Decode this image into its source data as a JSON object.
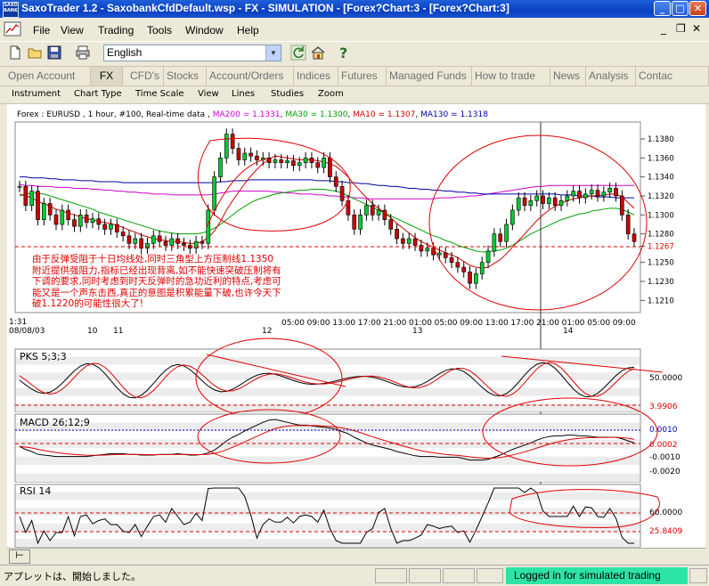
{
  "window": {
    "title": "SaxoTrader 1.2 - SaxobankCfdDefault.wsp - FX - SIMULATION - [Forex?Chart:3 - [Forex?Chart:3]",
    "app_icon_text": "SAXO BANK"
  },
  "menu": {
    "items": [
      "File",
      "View",
      "Trading",
      "Tools",
      "Window",
      "Help"
    ]
  },
  "toolbar": {
    "language": "English"
  },
  "nav_tabs": [
    "Open Account",
    "FX",
    "CFD's",
    "Stocks",
    "Account/Orders",
    "Indices",
    "Futures",
    "Managed Funds",
    "How to trade",
    "News",
    "Analysis",
    "Contac"
  ],
  "active_tab": "FX",
  "chart_toolbar": [
    "Instrument",
    "Chart Type",
    "Time Scale",
    "View",
    "Lines",
    "Studies",
    "Zoom"
  ],
  "legend": {
    "prefix": "Forex : EURUSD , 1 hour, #100, Real-time data ,",
    "ma200": "MA200 = 1.1331",
    "ma30": "MA30 = 1.1300",
    "ma10": "MA10 = 1.1307",
    "ma130": "MA130 = 1.1318",
    "colors": {
      "ma200": "#d000d0",
      "ma30": "#00a000",
      "ma10": "#d00000",
      "ma130": "#0000a0"
    }
  },
  "annotation_text": "由于反弹受阻于十日均线处,同时三角型上方压制线1.1350附近提供强阻力,指标已经出现背离,如不能快速突破压制将有下调的要求,同时考虑到时天反弹时的急功近利的特点,考虑可能又是一个声东击西,真正的意图是积累能量下破,也许今天下破1.1220的可能性很大了!",
  "panels": {
    "pks": {
      "label": "PKS 5;3;3",
      "values": [
        "50.0000",
        "3.9906"
      ]
    },
    "macd": {
      "label": "MACD 26;12;9",
      "values": [
        "0.0010",
        "0.0002",
        "-0.0010",
        "-0.0020"
      ]
    },
    "rsi": {
      "label": "RSI 14",
      "values": [
        "60.0000",
        "25.8409"
      ]
    }
  },
  "chart_data": {
    "type": "candlestick",
    "instrument": "EURUSD",
    "timeframe": "1 hour",
    "y_ticks": [
      "1.1380",
      "1.1360",
      "1.1340",
      "1.1320",
      "1.1300",
      "1.1280",
      "1.1267",
      "1.1250",
      "1.1230",
      "1.1210"
    ],
    "ylim": [
      1.12,
      1.1395
    ],
    "current_price": "1.1267",
    "x_date_labels": [
      "1:31",
      "08/08/03",
      "10",
      "11",
      "12",
      "13",
      "14"
    ],
    "x_time_labels": [
      "05:00",
      "09:00",
      "13:00",
      "17:00",
      "21:00",
      "01:00",
      "05:00",
      "09:00",
      "13:00",
      "17:00",
      "21:00",
      "01:00",
      "05:00",
      "09:00"
    ],
    "closes": [
      1.133,
      1.131,
      1.1325,
      1.1295,
      1.1312,
      1.13,
      1.129,
      1.1305,
      1.1295,
      1.1288,
      1.13,
      1.1292,
      1.1296,
      1.129,
      1.1285,
      1.129,
      1.1282,
      1.1278,
      1.127,
      1.1275,
      1.1265,
      1.127,
      1.1278,
      1.1272,
      1.1268,
      1.1275,
      1.127,
      1.1268,
      1.1265,
      1.1272,
      1.127,
      1.1305,
      1.134,
      1.136,
      1.1385,
      1.137,
      1.1358,
      1.1365,
      1.1362,
      1.1358,
      1.136,
      1.1355,
      1.1358,
      1.1355,
      1.1357,
      1.1352,
      1.1355,
      1.136,
      1.1355,
      1.135,
      1.136,
      1.134,
      1.133,
      1.1315,
      1.13,
      1.1285,
      1.13,
      1.131,
      1.13,
      1.1305,
      1.1295,
      1.1285,
      1.1275,
      1.127,
      1.1275,
      1.1268,
      1.1262,
      1.1265,
      1.1258,
      1.126,
      1.1255,
      1.125,
      1.1245,
      1.124,
      1.1228,
      1.1238,
      1.125,
      1.1262,
      1.128,
      1.1272,
      1.129,
      1.1305,
      1.1318,
      1.131,
      1.1315,
      1.132,
      1.1312,
      1.1318,
      1.131,
      1.1315,
      1.132,
      1.1325,
      1.1318,
      1.1322,
      1.1326,
      1.132,
      1.1324,
      1.1328,
      1.132,
      1.13,
      1.128,
      1.1272
    ],
    "ma200": [
      1.1332,
      1.1331,
      1.1331,
      1.133,
      1.133,
      1.133,
      1.1329,
      1.1329,
      1.1329,
      1.1328,
      1.1328,
      1.1328,
      1.1327,
      1.1327,
      1.1326,
      1.1326,
      1.1325,
      1.1325,
      1.1324,
      1.1324,
      1.1323,
      1.1323,
      1.1322,
      1.1322,
      1.1322,
      1.1321,
      1.1321,
      1.1321,
      1.1321,
      1.1321,
      1.1321,
      1.1321,
      1.1322,
      1.1323,
      1.1324,
      1.1325,
      1.1325,
      1.1325,
      1.1325,
      1.1325,
      1.1325,
      1.1325,
      1.1324,
      1.1324,
      1.1323,
      1.1323,
      1.1322,
      1.1322,
      1.1322,
      1.1321,
      1.1321,
      1.132,
      1.132,
      1.1319,
      1.1319,
      1.1318,
      1.1318,
      1.1317,
      1.1317,
      1.1317,
      1.1317,
      1.1317,
      1.1317,
      1.1317,
      1.1317,
      1.1317,
      1.1317,
      1.1317,
      1.1317,
      1.1318,
      1.1318,
      1.1318,
      1.1319,
      1.1319,
      1.132,
      1.132,
      1.1321,
      1.1322,
      1.1323,
      1.1324,
      1.1325,
      1.1326,
      1.1327,
      1.1328,
      1.1329,
      1.133,
      1.133,
      1.1331,
      1.1331,
      1.1331,
      1.1331,
      1.1331,
      1.1331,
      1.1331,
      1.1331,
      1.1331,
      1.1331,
      1.1331,
      1.1331,
      1.1331,
      1.1331,
      1.1331
    ],
    "ma130": [
      1.134,
      1.134,
      1.1339,
      1.1339,
      1.1339,
      1.1338,
      1.1338,
      1.1337,
      1.1337,
      1.1337,
      1.1336,
      1.1336,
      1.1336,
      1.1335,
      1.1335,
      1.1335,
      1.1335,
      1.1334,
      1.1334,
      1.1334,
      1.1334,
      1.1334,
      1.1334,
      1.1334,
      1.1334,
      1.1334,
      1.1334,
      1.1334,
      1.1334,
      1.1334,
      1.1334,
      1.1334,
      1.1334,
      1.1335,
      1.1335,
      1.1336,
      1.1336,
      1.1336,
      1.1337,
      1.1337,
      1.1337,
      1.1337,
      1.1337,
      1.1337,
      1.1337,
      1.1337,
      1.1337,
      1.1337,
      1.1337,
      1.1336,
      1.1336,
      1.1336,
      1.1335,
      1.1335,
      1.1334,
      1.1334,
      1.1333,
      1.1333,
      1.1332,
      1.1331,
      1.1331,
      1.133,
      1.133,
      1.1329,
      1.1328,
      1.1328,
      1.1327,
      1.1327,
      1.1326,
      1.1326,
      1.1325,
      1.1325,
      1.1324,
      1.1324,
      1.1323,
      1.1323,
      1.1322,
      1.1322,
      1.1322,
      1.1322,
      1.1322,
      1.1322,
      1.1322,
      1.1322,
      1.1322,
      1.1322,
      1.1322,
      1.1322,
      1.1322,
      1.1321,
      1.1321,
      1.1321,
      1.132,
      1.132,
      1.132,
      1.1319,
      1.1319,
      1.1319,
      1.1318,
      1.1318,
      1.1318,
      1.1318
    ],
    "ma30": [
      1.132,
      1.1322,
      1.1323,
      1.1323,
      1.1322,
      1.132,
      1.1318,
      1.1316,
      1.1314,
      1.1312,
      1.131,
      1.1308,
      1.1306,
      1.1303,
      1.1301,
      1.1299,
      1.1297,
      1.1295,
      1.1293,
      1.1291,
      1.1289,
      1.1287,
      1.1285,
      1.1283,
      1.1282,
      1.1281,
      1.128,
      1.128,
      1.128,
      1.128,
      1.1281,
      1.1283,
      1.1286,
      1.129,
      1.1295,
      1.13,
      1.1305,
      1.1309,
      1.1313,
      1.1316,
      1.1318,
      1.132,
      1.1322,
      1.1323,
      1.1324,
      1.1325,
      1.1326,
      1.1326,
      1.1327,
      1.1327,
      1.1327,
      1.1326,
      1.1325,
      1.1323,
      1.132,
      1.1317,
      1.1314,
      1.1311,
      1.1308,
      1.1305,
      1.1302,
      1.1299,
      1.1296,
      1.1293,
      1.129,
      1.1287,
      1.1284,
      1.1281,
      1.1278,
      1.1276,
      1.1273,
      1.1271,
      1.1268,
      1.1266,
      1.1264,
      1.1262,
      1.1261,
      1.1261,
      1.1262,
      1.1263,
      1.1265,
      1.1268,
      1.1272,
      1.1276,
      1.128,
      1.1283,
      1.1286,
      1.1289,
      1.1292,
      1.1295,
      1.1297,
      1.1299,
      1.1301,
      1.1302,
      1.1304,
      1.1305,
      1.1306,
      1.1307,
      1.1307,
      1.1306,
      1.1303,
      1.13
    ],
    "ma10": [
      1.1322,
      1.132,
      1.1318,
      1.1314,
      1.1312,
      1.1309,
      1.1306,
      1.1304,
      1.1302,
      1.13,
      1.1298,
      1.1296,
      1.1295,
      1.1293,
      1.1292,
      1.1291,
      1.1289,
      1.1287,
      1.1284,
      1.1282,
      1.1279,
      1.1277,
      1.1275,
      1.1274,
      1.1273,
      1.1272,
      1.1272,
      1.1271,
      1.127,
      1.127,
      1.1272,
      1.1276,
      1.1283,
      1.1293,
      1.1305,
      1.1315,
      1.1324,
      1.1333,
      1.1341,
      1.1348,
      1.1354,
      1.1359,
      1.1362,
      1.1361,
      1.136,
      1.1359,
      1.1358,
      1.1358,
      1.1358,
      1.1357,
      1.1356,
      1.1354,
      1.1351,
      1.1346,
      1.134,
      1.1332,
      1.1325,
      1.1318,
      1.1312,
      1.1307,
      1.1302,
      1.1297,
      1.1291,
      1.1286,
      1.1281,
      1.1276,
      1.1272,
      1.1269,
      1.1266,
      1.1263,
      1.126,
      1.1258,
      1.1255,
      1.1251,
      1.1247,
      1.1245,
      1.1244,
      1.1245,
      1.1249,
      1.1253,
      1.1259,
      1.1266,
      1.1273,
      1.128,
      1.1287,
      1.1294,
      1.13,
      1.1305,
      1.1309,
      1.1312,
      1.1315,
      1.1317,
      1.1318,
      1.1319,
      1.132,
      1.132,
      1.1321,
      1.1322,
      1.1322,
      1.1319,
      1.1313,
      1.1307
    ]
  }
}
